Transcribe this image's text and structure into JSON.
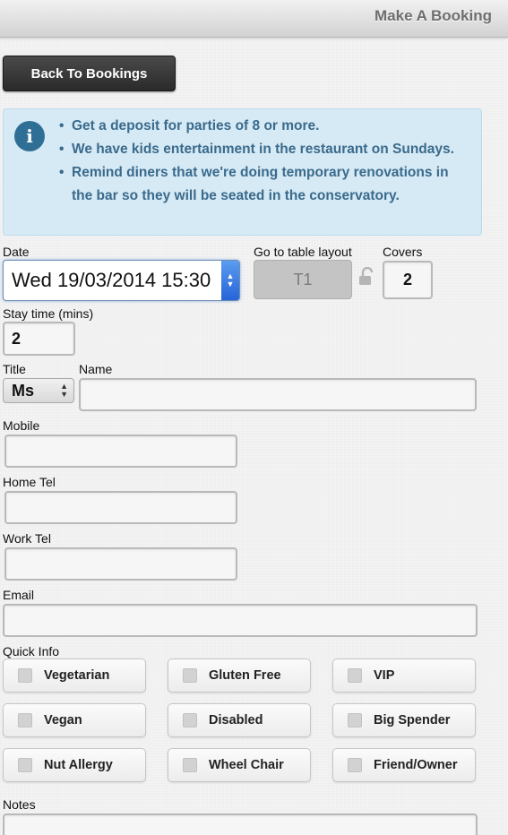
{
  "header": {
    "title": "Make A Booking"
  },
  "back_button": {
    "label": "Back To Bookings"
  },
  "info": {
    "items": [
      "Get a deposit for parties of 8 or more.",
      "We have kids entertainment in the restaurant on Sundays.",
      "Remind diners that we're doing temporary renovations in the bar so they will be seated in the conservatory."
    ]
  },
  "form": {
    "date_label": "Date",
    "date_value": "Wed 19/03/2014 15:30",
    "table_layout_label": "Go to table layout",
    "table_value": "T1",
    "covers_label": "Covers",
    "covers_value": "2",
    "stay_label": "Stay time (mins)",
    "stay_value": "2",
    "title_label": "Title",
    "title_value": "Ms",
    "name_label": "Name",
    "name_value": "",
    "mobile_label": "Mobile",
    "home_tel_label": "Home Tel",
    "work_tel_label": "Work Tel",
    "email_label": "Email",
    "quick_info_label": "Quick Info",
    "notes_label": "Notes"
  },
  "quick_info": [
    "Vegetarian",
    "Gluten Free",
    "VIP",
    "Vegan",
    "Disabled",
    "Big Spender",
    "Nut Allergy",
    "Wheel Chair",
    "Friend/Owner"
  ]
}
